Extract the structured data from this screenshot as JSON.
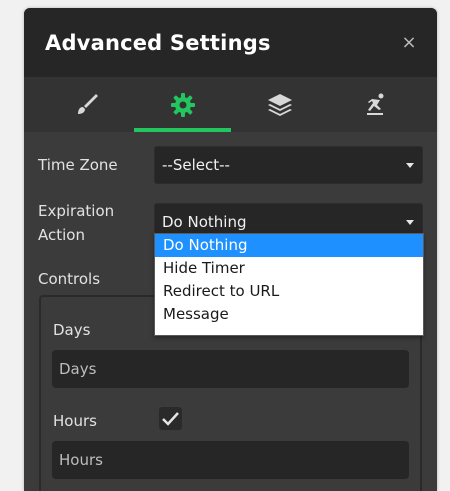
{
  "dialog": {
    "title": "Advanced Settings",
    "close_symbol": "×"
  },
  "tabs": [
    {
      "icon": "paintbrush-icon",
      "active": false
    },
    {
      "icon": "gear-icon",
      "active": true
    },
    {
      "icon": "layers-icon",
      "active": false
    },
    {
      "icon": "skater-icon",
      "active": false
    }
  ],
  "colors": {
    "accent": "#22c55e",
    "selected_option": "#1e90ff"
  },
  "settings": {
    "time_zone": {
      "label": "Time Zone",
      "value": "--Select--"
    },
    "expiration_action": {
      "label_line1": "Expiration",
      "label_line2": "Action",
      "value": "Do Nothing",
      "options": [
        "Do Nothing",
        "Hide Timer",
        "Redirect to URL",
        "Message"
      ],
      "selected_index": 0
    }
  },
  "controls": {
    "label": "Controls",
    "days": {
      "label": "Days",
      "placeholder": "Days",
      "checked": false
    },
    "hours": {
      "label": "Hours",
      "placeholder": "Hours",
      "checked": true
    }
  }
}
